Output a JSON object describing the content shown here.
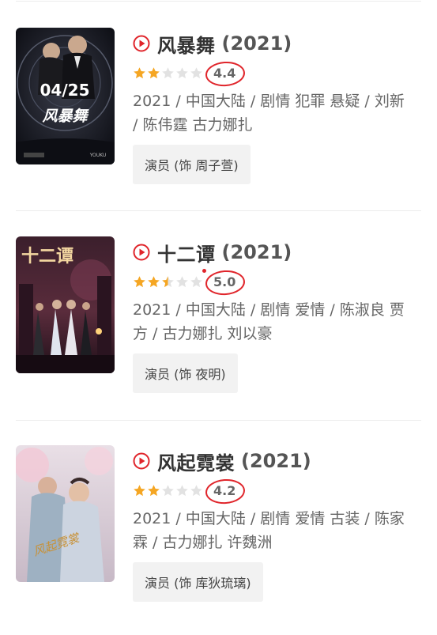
{
  "items": [
    {
      "title": "风暴舞",
      "year": "(2021)",
      "score": "4.4",
      "stars": [
        "full",
        "full",
        "empty",
        "empty",
        "empty"
      ],
      "meta": "2021 / 中国大陆 / 剧情 犯罪 悬疑 / 刘新 / 陈伟霆 古力娜扎",
      "role": "演员 (饰 周子萱)",
      "poster_text": {
        "date": "04/25",
        "title": "风暴舞",
        "brand": "YOUKU"
      }
    },
    {
      "title": "十二谭",
      "year": "(2021)",
      "score": "5.0",
      "stars": [
        "full",
        "full",
        "half",
        "empty",
        "empty"
      ],
      "meta": "2021 / 中国大陆 / 剧情 爱情 / 陈淑良 贾方 / 古力娜扎 刘以豪",
      "role": "演员 (饰 夜明)",
      "poster_text": {
        "title": "十二谭"
      }
    },
    {
      "title": "风起霓裳",
      "year": "(2021)",
      "score": "4.2",
      "stars": [
        "full",
        "full",
        "empty",
        "empty",
        "empty"
      ],
      "meta": "2021 / 中国大陆 / 剧情 爱情 古装 / 陈家霖 / 古力娜扎 许魏洲",
      "role": "演员 (饰 库狄琉璃)",
      "poster_text": {
        "title": "风起霓裳"
      }
    }
  ],
  "colors": {
    "accent_red": "#e0252b",
    "star_gold": "#f5a623",
    "star_empty": "#e2e2e2"
  },
  "icons": {
    "play": "play-circle-icon",
    "star": "star-icon"
  }
}
